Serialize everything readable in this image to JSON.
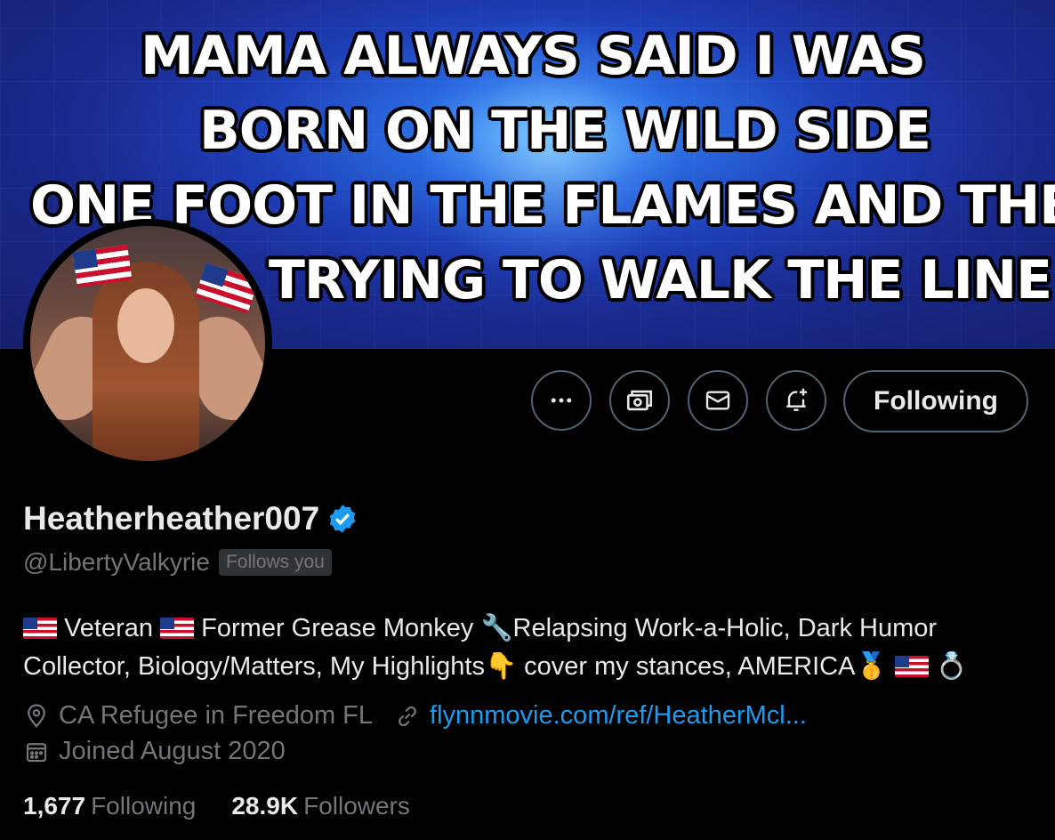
{
  "banner": {
    "lines": [
      "MAMA ALWAYS SAID I WAS",
      "BORN ON THE WILD SIDE",
      "ONE FOOT IN THE FLAMES AND THE",
      "TRYING TO WALK THE LINE"
    ]
  },
  "actions": {
    "more_icon": "more-icon",
    "tip_icon": "tip-money-icon",
    "message_icon": "envelope-icon",
    "notify_icon": "bell-plus-icon",
    "follow_label": "Following"
  },
  "profile": {
    "display_name": "Heatherheather007",
    "handle": "@LibertyValkyrie",
    "follows_you": "Follows you",
    "bio_line1_a": "Veteran",
    "bio_line1_b": "Former Grease Monkey",
    "bio_line1_c": "Relapsing Work-a-Holic, Dark Humor",
    "bio_line2_a": "Collector, Biology/Matters, My Highlights",
    "bio_line2_b": "cover my stances, AMERICA",
    "location": "CA Refugee in Freedom FL",
    "link": "flynnmovie.com/ref/HeatherMcl...",
    "joined": "Joined August 2020"
  },
  "stats": {
    "following_count": "1,677",
    "following_label": "Following",
    "followers_count": "28.9K",
    "followers_label": "Followers"
  },
  "colors": {
    "background": "#000000",
    "text": "#e7e9ea",
    "muted": "#71767b",
    "link": "#1d9bf0",
    "verified": "#1d9bf0",
    "border": "#536471"
  }
}
